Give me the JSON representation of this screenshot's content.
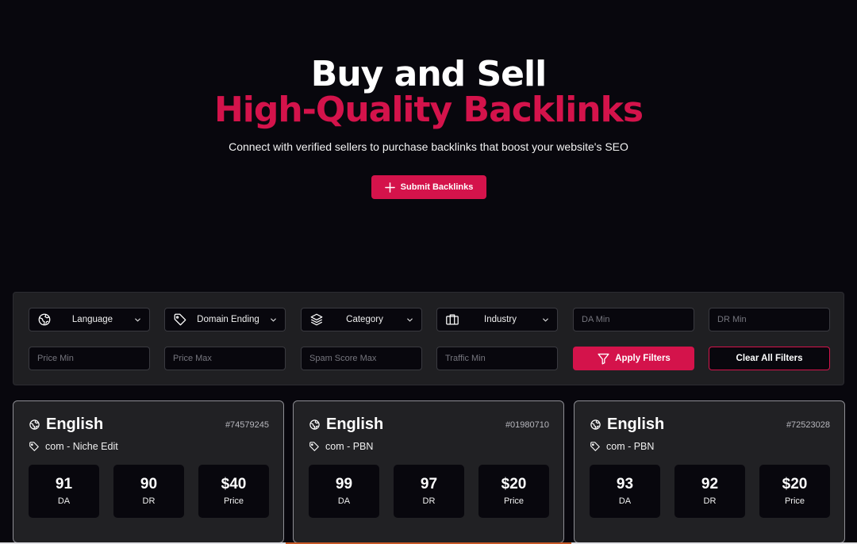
{
  "hero": {
    "title_line1": "Buy and Sell",
    "title_line2": "High-Quality Backlinks",
    "subtitle": "Connect with verified sellers to purchase backlinks that boost your website's SEO",
    "submit_label": "Submit Backlinks"
  },
  "filters": {
    "language": "Language",
    "domain_ending": "Domain Ending",
    "category": "Category",
    "industry": "Industry",
    "da_min_placeholder": "DA Min",
    "dr_min_placeholder": "DR Min",
    "price_min_placeholder": "Price Min",
    "price_max_placeholder": "Price Max",
    "spam_score_max_placeholder": "Spam Score Max",
    "traffic_min_placeholder": "Traffic Min",
    "apply_label": "Apply Filters",
    "clear_label": "Clear All Filters"
  },
  "stat_labels": {
    "da": "DA",
    "dr": "DR",
    "price": "Price"
  },
  "listings": [
    {
      "language": "English",
      "id": "#74579245",
      "tag": "com - Niche Edit",
      "da": "91",
      "dr": "90",
      "price": "$40"
    },
    {
      "language": "English",
      "id": "#01980710",
      "tag": "com - PBN",
      "da": "99",
      "dr": "97",
      "price": "$20"
    },
    {
      "language": "English",
      "id": "#72523028",
      "tag": "com - PBN",
      "da": "93",
      "dr": "92",
      "price": "$20"
    }
  ],
  "colors": {
    "accent": "#d4134b",
    "background": "#08070d",
    "panel": "#1f1f22",
    "card": "#212124"
  },
  "icons": {
    "submit": "plus-icon",
    "language": "globe-icon",
    "domain": "tag-icon",
    "category": "layers-icon",
    "industry": "briefcase-icon",
    "apply": "filter-icon"
  }
}
